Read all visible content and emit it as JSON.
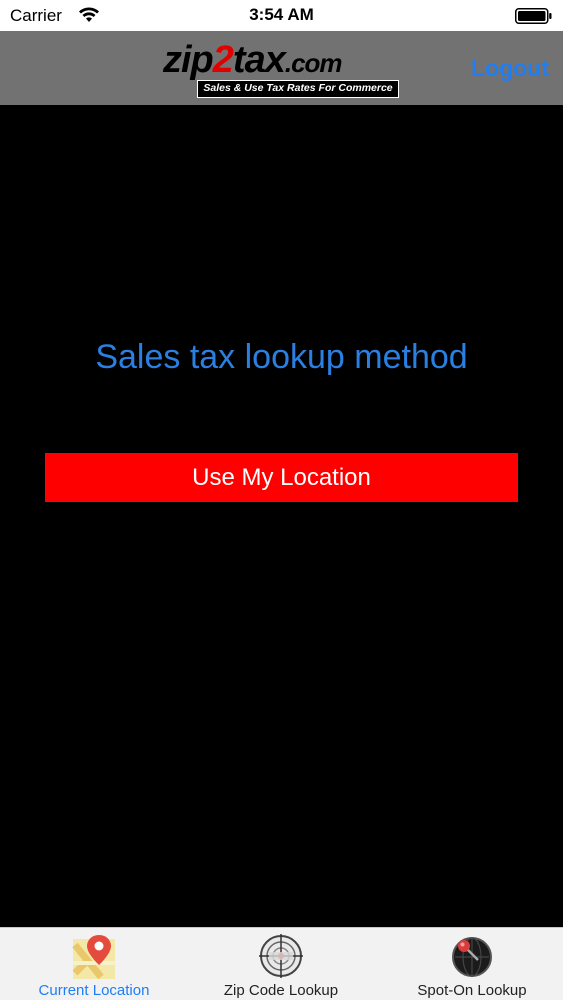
{
  "status_bar": {
    "carrier": "Carrier",
    "time": "3:54 AM"
  },
  "nav": {
    "logo": {
      "part1": "zip",
      "part2": "2",
      "part3": "tax",
      "domain": ".com",
      "tagline": "Sales & Use Tax Rates For Commerce"
    },
    "logout_label": "Logout"
  },
  "main": {
    "title": "Sales tax lookup method",
    "button_label": "Use My Location"
  },
  "tabs": [
    {
      "label": "Current Location",
      "icon": "map-pin-icon",
      "active": true
    },
    {
      "label": "Zip Code Lookup",
      "icon": "target-icon",
      "active": false
    },
    {
      "label": "Spot-On Lookup",
      "icon": "globe-pin-icon",
      "active": false
    }
  ],
  "colors": {
    "accent_blue": "#1f7ef5",
    "button_red": "#ff0000",
    "nav_gray": "#727272",
    "background": "#000000"
  }
}
